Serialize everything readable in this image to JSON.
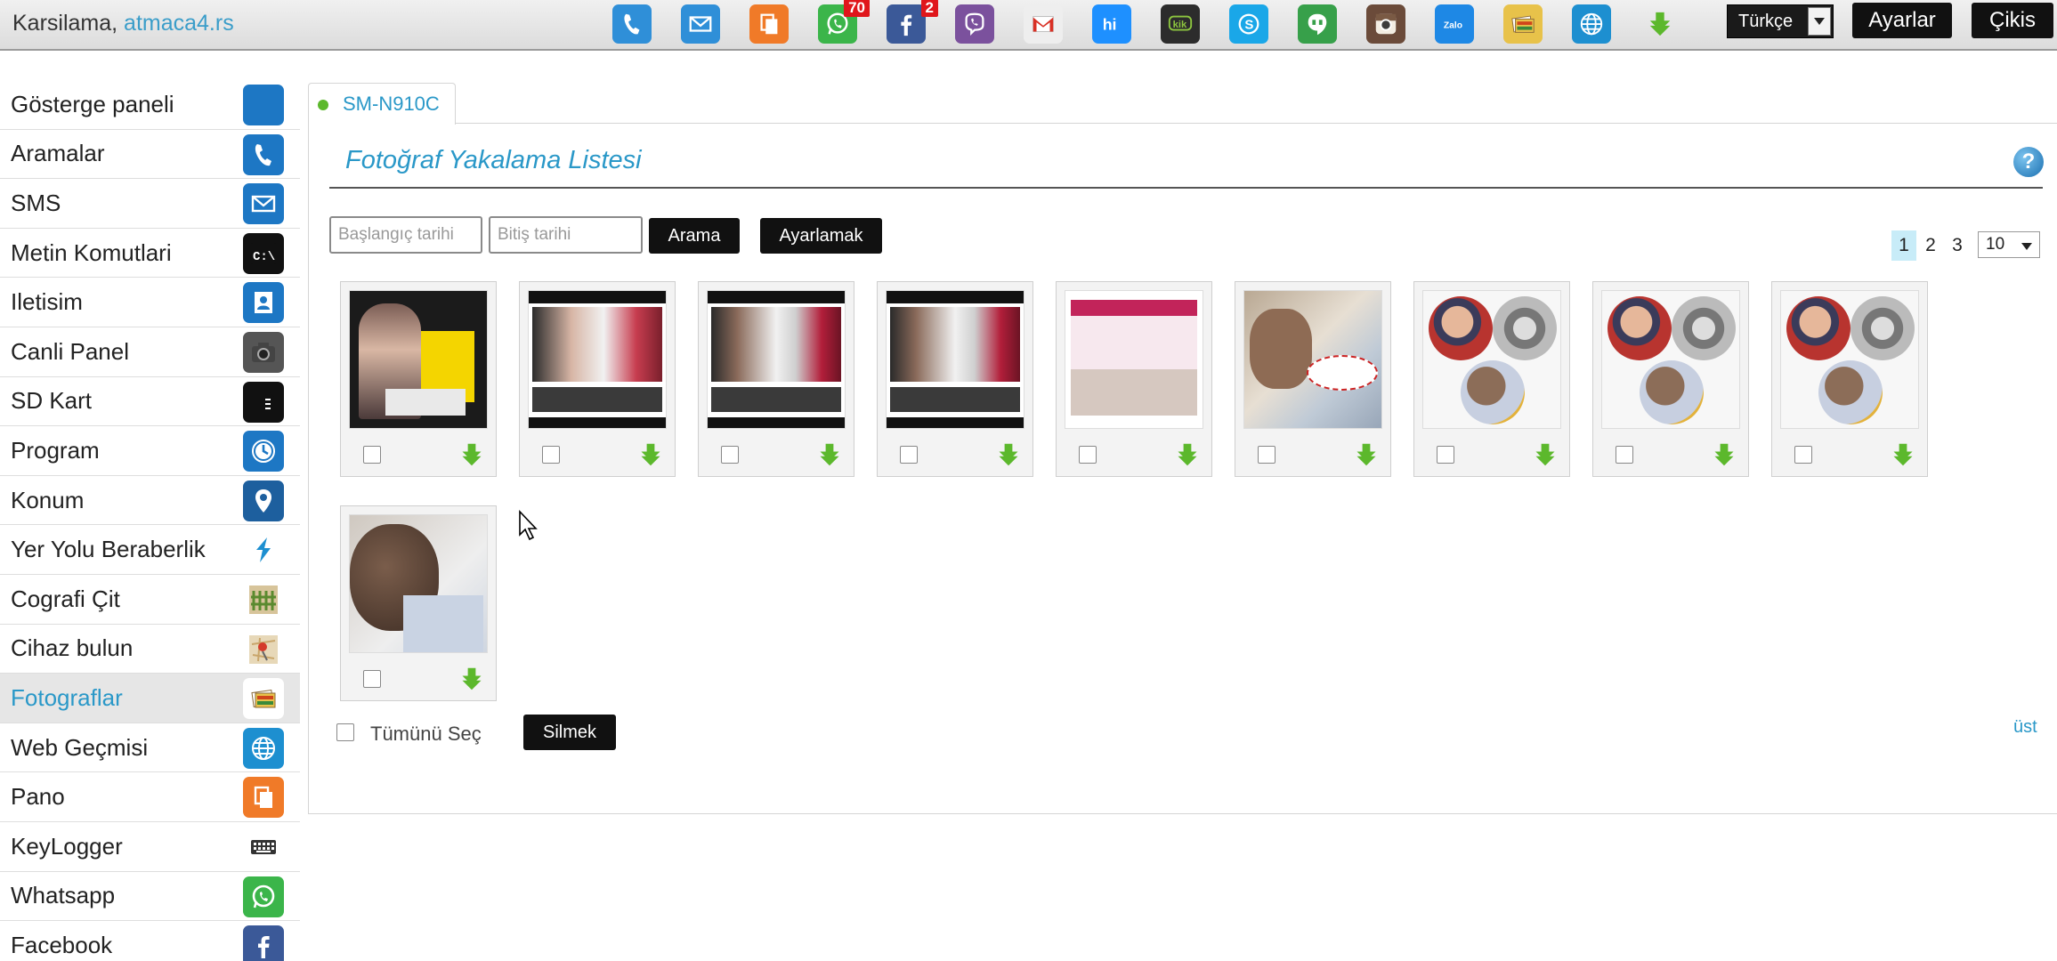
{
  "header": {
    "welcome": "Karsilama,",
    "username": "atmaca4.rs",
    "apps": [
      {
        "icon": "phone-icon",
        "color": "#2f8fd8",
        "badge": ""
      },
      {
        "icon": "mail-icon",
        "color": "#2f8fd8",
        "badge": ""
      },
      {
        "icon": "clipboard-icon",
        "color": "#f07a28",
        "badge": ""
      },
      {
        "icon": "whatsapp-icon",
        "color": "#3bb54a",
        "badge": "70"
      },
      {
        "icon": "facebook-icon",
        "color": "#3b5998",
        "badge": "2"
      },
      {
        "icon": "viber-icon",
        "color": "#7b519d",
        "badge": ""
      },
      {
        "icon": "gmail-icon",
        "color": "#eeeeee",
        "badge": ""
      },
      {
        "icon": "hike-icon",
        "color": "#1e90ff",
        "badge": ""
      },
      {
        "icon": "kik-icon",
        "color": "#2c2c2c",
        "badge": ""
      },
      {
        "icon": "skype-icon",
        "color": "#1aa7e8",
        "badge": ""
      },
      {
        "icon": "hangouts-icon",
        "color": "#37a04a",
        "badge": ""
      },
      {
        "icon": "instagram-icon",
        "color": "#6b4b3a",
        "badge": ""
      },
      {
        "icon": "zalo-icon",
        "color": "#1e88e5",
        "badge": ""
      },
      {
        "icon": "photos-icon",
        "color": "#e8c24a",
        "badge": ""
      },
      {
        "icon": "globe-icon",
        "color": "#1d8fd0",
        "badge": ""
      },
      {
        "icon": "download-icon",
        "color": "#5cb82c",
        "badge": ""
      }
    ],
    "language": "Türkçe",
    "settings_label": "Ayarlar",
    "logout_label": "Çikis"
  },
  "sidebar": {
    "items": [
      {
        "label": "Gösterge paneli",
        "icon": "home-icon",
        "color": "#1d77c4"
      },
      {
        "label": "Aramalar",
        "icon": "phone-icon",
        "color": "#1d77c4"
      },
      {
        "label": "SMS",
        "icon": "mail-icon",
        "color": "#1d77c4"
      },
      {
        "label": "Metin Komutlari",
        "icon": "terminal-icon",
        "color": "#111111"
      },
      {
        "label": "Iletisim",
        "icon": "contact-icon",
        "color": "#1d77c4"
      },
      {
        "label": "Canli Panel",
        "icon": "camera-icon",
        "color": "#555555"
      },
      {
        "label": "SD Kart",
        "icon": "sdcard-icon",
        "color": "#111111"
      },
      {
        "label": "Program",
        "icon": "clock-icon",
        "color": "#1d77c4"
      },
      {
        "label": "Konum",
        "icon": "location-pin-icon",
        "color": "#1d5f9e"
      },
      {
        "label": "Yer Yolu Beraberlik",
        "icon": "route-icon",
        "color": "#ffffff"
      },
      {
        "label": "Cografi Çit",
        "icon": "fence-icon",
        "color": "#ffffff"
      },
      {
        "label": "Cihaz bulun",
        "icon": "map-pin-icon",
        "color": "#ffffff"
      },
      {
        "label": "Fotograflar",
        "icon": "photos-icon",
        "color": "#ffffff",
        "active": true
      },
      {
        "label": "Web Geçmisi",
        "icon": "globe-icon",
        "color": "#1d8fd0"
      },
      {
        "label": "Pano",
        "icon": "clipboard-icon",
        "color": "#f07a28"
      },
      {
        "label": "KeyLogger",
        "icon": "keyboard-icon",
        "color": "#ffffff"
      },
      {
        "label": "Whatsapp",
        "icon": "whatsapp-icon",
        "color": "#3bb54a"
      },
      {
        "label": "Facebook",
        "icon": "facebook-icon",
        "color": "#3b5998"
      }
    ]
  },
  "main": {
    "device_tab": "SM-N910C",
    "title": "Fotoğraf Yakalama Listesi",
    "start_placeholder": "Başlangıç tarihi",
    "end_placeholder": "Bitiş tarihi",
    "search_label": "Arama",
    "adjust_label": "Ayarlamak",
    "pages": [
      "1",
      "2",
      "3"
    ],
    "current_page": "1",
    "per_page": "10",
    "photos": [
      {
        "thumb": "poster"
      },
      {
        "thumb": "web"
      },
      {
        "thumb": "eye"
      },
      {
        "thumb": "eye"
      },
      {
        "thumb": "pink"
      },
      {
        "thumb": "baby"
      },
      {
        "thumb": "circles"
      },
      {
        "thumb": "circles"
      },
      {
        "thumb": "circles"
      },
      {
        "thumb": "child"
      }
    ],
    "select_all_label": "Tümünü Seç",
    "delete_label": "Silmek",
    "top_link": "üst"
  }
}
